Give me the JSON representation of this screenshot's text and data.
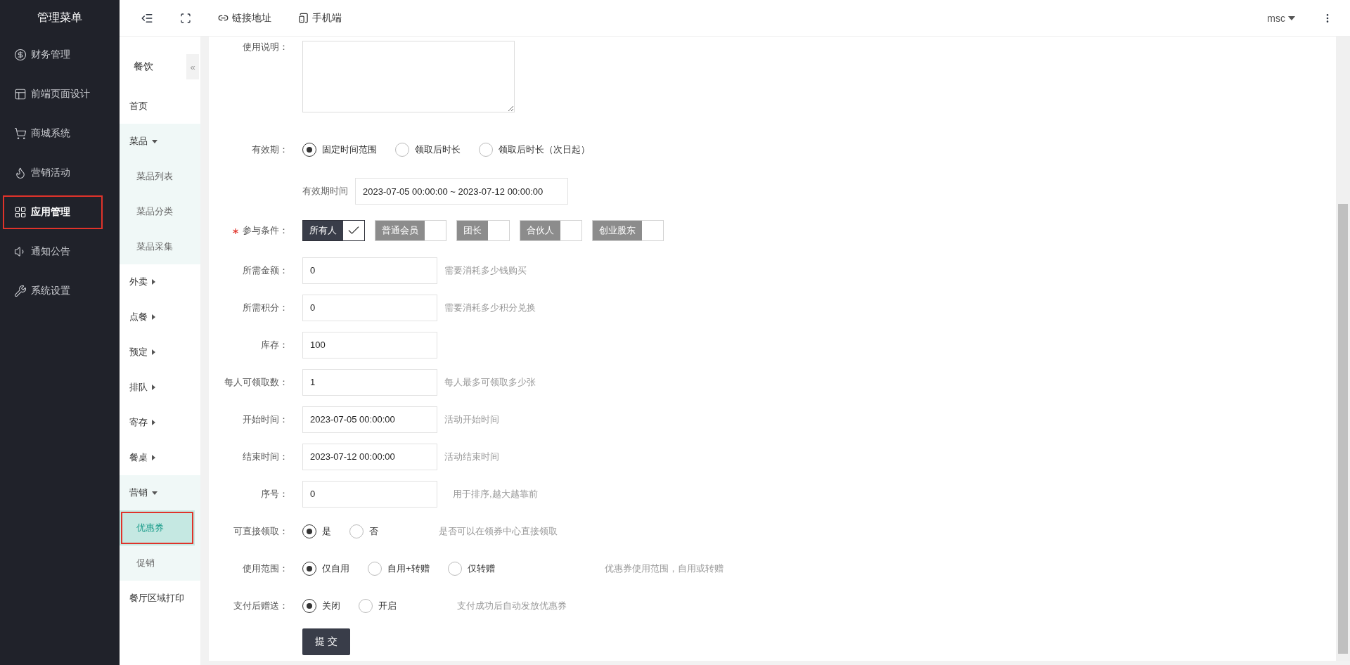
{
  "sidebar": {
    "title": "管理菜单",
    "items": [
      {
        "label": "财务管理",
        "selected": false
      },
      {
        "label": "前端页面设计",
        "selected": false
      },
      {
        "label": "商城系统",
        "selected": false
      },
      {
        "label": "营销活动",
        "selected": false
      },
      {
        "label": "应用管理",
        "selected": true
      },
      {
        "label": "通知公告",
        "selected": false
      },
      {
        "label": "系统设置",
        "selected": false
      }
    ]
  },
  "topbar": {
    "links": [
      {
        "label": "链接地址"
      },
      {
        "label": "手机端"
      }
    ],
    "user": "msc"
  },
  "subnav": {
    "title": "餐饮",
    "collapse": "«",
    "items": [
      {
        "label": "首页",
        "selected": false
      },
      {
        "label": "菜品",
        "expanded": true,
        "selected": false,
        "children": [
          {
            "label": "菜品列表",
            "selected": false
          },
          {
            "label": "菜品分类",
            "selected": false
          },
          {
            "label": "菜品采集",
            "selected": false
          }
        ]
      },
      {
        "label": "外卖",
        "expanded": false,
        "selected": false
      },
      {
        "label": "点餐",
        "expanded": false,
        "selected": false
      },
      {
        "label": "预定",
        "expanded": false,
        "selected": false
      },
      {
        "label": "排队",
        "expanded": false,
        "selected": false
      },
      {
        "label": "寄存",
        "expanded": false,
        "selected": false
      },
      {
        "label": "餐桌",
        "expanded": false,
        "selected": false
      },
      {
        "label": "营销",
        "expanded": true,
        "selected": false,
        "children": [
          {
            "label": "优惠券",
            "selected": true
          },
          {
            "label": "促销",
            "selected": false
          }
        ]
      },
      {
        "label": "餐厅区域打印",
        "selected": false
      }
    ]
  },
  "form": {
    "rows": [
      {
        "kind": "textarea",
        "label": "使用说明："
      },
      {
        "kind": "radio",
        "label": "有效期：",
        "options": [
          {
            "label": "固定时间范围",
            "selected": true
          },
          {
            "label": "领取后时长",
            "selected": false
          },
          {
            "label": "领取后时长（次日起）",
            "selected": false
          }
        ]
      },
      {
        "kind": "range",
        "sublabel": "有效期时间",
        "value": "2023-07-05 00:00:00 ~ 2023-07-12 00:00:00"
      },
      {
        "kind": "tags",
        "label": "参与条件：",
        "required": true,
        "options": [
          {
            "label": "所有人",
            "checked": true
          },
          {
            "label": "普通会员",
            "checked": false
          },
          {
            "label": "团长",
            "checked": false
          },
          {
            "label": "合伙人",
            "checked": false
          },
          {
            "label": "创业股东",
            "checked": false
          }
        ]
      },
      {
        "kind": "input",
        "label": "所需金额：",
        "value": "0",
        "hint": "需要消耗多少钱购买"
      },
      {
        "kind": "input",
        "label": "所需积分：",
        "value": "0",
        "hint": "需要消耗多少积分兑换"
      },
      {
        "kind": "input",
        "label": "库存：",
        "value": "100"
      },
      {
        "kind": "input",
        "label": "每人可领取数：",
        "value": "1",
        "hint": "每人最多可领取多少张"
      },
      {
        "kind": "input",
        "label": "开始时间：",
        "value": "2023-07-05 00:00:00",
        "hint": "活动开始时间"
      },
      {
        "kind": "input",
        "label": "结束时间：",
        "value": "2023-07-12 00:00:00",
        "hint": "活动结束时间"
      },
      {
        "kind": "input",
        "label": "序号：",
        "value": "0",
        "hint": "用于排序,越大越靠前"
      },
      {
        "kind": "radio",
        "label": "可直接领取：",
        "options": [
          {
            "label": "是",
            "selected": true
          },
          {
            "label": "否",
            "selected": false
          }
        ],
        "hint": "是否可以在领券中心直接领取"
      },
      {
        "kind": "radio",
        "label": "使用范围：",
        "options": [
          {
            "label": "仅自用",
            "selected": true
          },
          {
            "label": "自用+转赠",
            "selected": false
          },
          {
            "label": "仅转赠",
            "selected": false
          }
        ],
        "hint": "优惠券使用范围，自用或转赠"
      },
      {
        "kind": "radio",
        "label": "支付后赠送：",
        "options": [
          {
            "label": "关闭",
            "selected": true
          },
          {
            "label": "开启",
            "selected": false
          }
        ],
        "hint": "支付成功后自动发放优惠券"
      },
      {
        "kind": "submit",
        "value": "提 交"
      }
    ]
  }
}
